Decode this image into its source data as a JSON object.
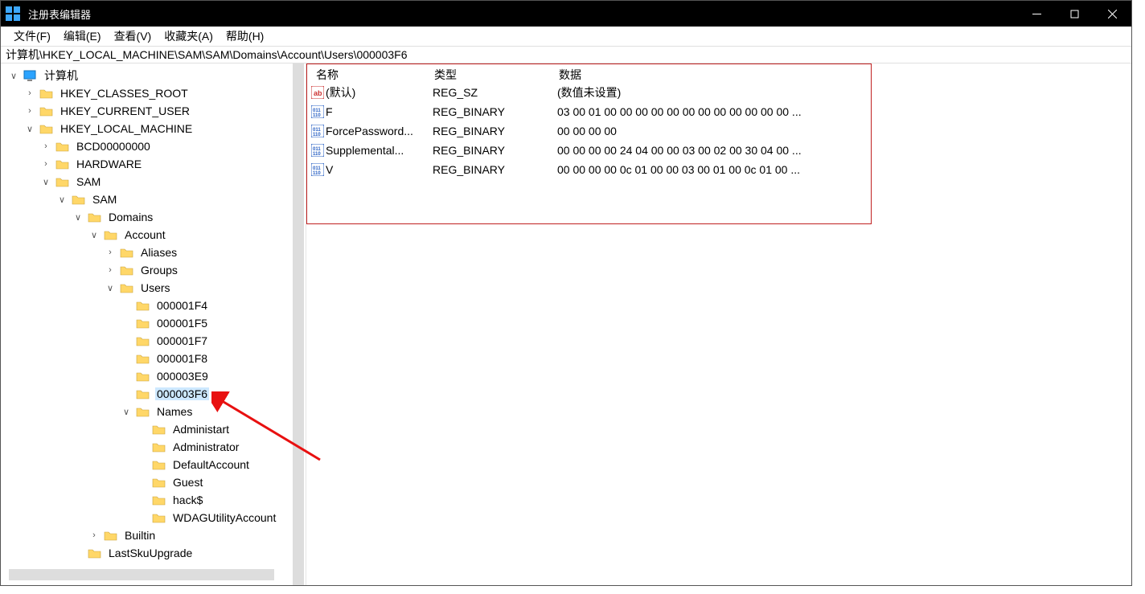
{
  "window": {
    "title": "注册表编辑器"
  },
  "menu": {
    "file": "文件(F)",
    "edit": "编辑(E)",
    "view": "查看(V)",
    "fav": "收藏夹(A)",
    "help": "帮助(H)"
  },
  "address": "计算机\\HKEY_LOCAL_MACHINE\\SAM\\SAM\\Domains\\Account\\Users\\000003F6",
  "tree": {
    "root": "计算机",
    "hkcr": "HKEY_CLASSES_ROOT",
    "hkcu": "HKEY_CURRENT_USER",
    "hklm": "HKEY_LOCAL_MACHINE",
    "bcd": "BCD00000000",
    "hardware": "HARDWARE",
    "sam1": "SAM",
    "sam2": "SAM",
    "domains": "Domains",
    "account": "Account",
    "aliases": "Aliases",
    "groups": "Groups",
    "users": "Users",
    "u_1f4": "000001F4",
    "u_1f5": "000001F5",
    "u_1f7": "000001F7",
    "u_1f8": "000001F8",
    "u_3e9": "000003E9",
    "u_3f6": "000003F6",
    "names": "Names",
    "n_admin1": "Administart",
    "n_admin2": "Administrator",
    "n_default": "DefaultAccount",
    "n_guest": "Guest",
    "n_hack": "hack$",
    "n_wdag": "WDAGUtilityAccount",
    "builtin": "Builtin",
    "lastsku": "LastSkuUpgrade"
  },
  "cols": {
    "name": "名称",
    "type": "类型",
    "data": "数据"
  },
  "rows": [
    {
      "icon": "sz",
      "name": "(默认)",
      "type": "REG_SZ",
      "data": "(数值未设置)"
    },
    {
      "icon": "bin",
      "name": "F",
      "type": "REG_BINARY",
      "data": "03 00 01 00 00 00 00 00 00 00 00 00 00 00 00 ..."
    },
    {
      "icon": "bin",
      "name": "ForcePassword...",
      "type": "REG_BINARY",
      "data": "00 00 00 00"
    },
    {
      "icon": "bin",
      "name": "Supplemental...",
      "type": "REG_BINARY",
      "data": "00 00 00 00 24 04 00 00 03 00 02 00 30 04 00 ..."
    },
    {
      "icon": "bin",
      "name": "V",
      "type": "REG_BINARY",
      "data": "00 00 00 00 0c 01 00 00 03 00 01 00 0c 01 00 ..."
    }
  ]
}
